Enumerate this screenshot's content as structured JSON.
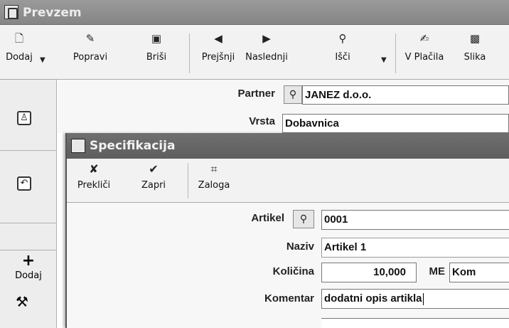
{
  "main_window": {
    "title": "Prevzem",
    "toolbar": [
      {
        "label": "Dodaj",
        "icon": "add-doc-icon"
      },
      {
        "label": "Popravi",
        "icon": "edit-icon"
      },
      {
        "label": "Briši",
        "icon": "delete-icon"
      },
      {
        "label": "Prejšnji",
        "icon": "prev-icon"
      },
      {
        "label": "Naslednji",
        "icon": "next-icon"
      },
      {
        "label": "Išči",
        "icon": "search-icon"
      },
      {
        "label": "V Plačila",
        "icon": "payments-icon"
      },
      {
        "label": "Slika",
        "icon": "image-icon"
      }
    ],
    "form": {
      "partner_label": "Partner",
      "partner_value": "JANEZ d.o.o.",
      "vrsta_label": "Vrsta",
      "vrsta_value": "Dobavnica"
    },
    "side_panel": {
      "add_label": "Dodaj"
    }
  },
  "dialog": {
    "title": "Specifikacija",
    "toolbar": [
      {
        "label": "Prekliči",
        "icon": "cancel-x-icon"
      },
      {
        "label": "Zapri",
        "icon": "checkmark-icon"
      },
      {
        "label": "Zaloga",
        "icon": "stock-icon"
      }
    ],
    "form": {
      "artikel_label": "Artikel",
      "artikel_value": "0001",
      "naziv_label": "Naziv",
      "naziv_value": "Artikel 1",
      "kolicina_label": "Količina",
      "kolicina_value": "10,000",
      "me_label": "ME",
      "me_value": "Kom",
      "komentar_label": "Komentar",
      "komentar_value": "dodatni opis artikla"
    }
  }
}
